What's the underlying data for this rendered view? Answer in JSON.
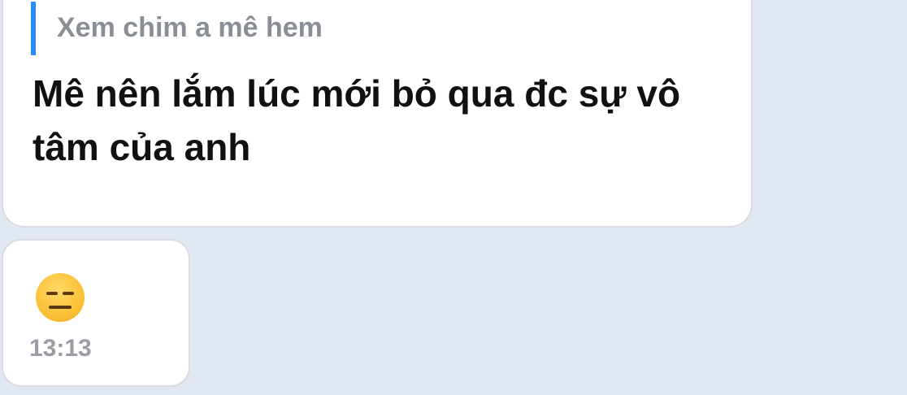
{
  "messages": {
    "main": {
      "quote_text": "Xem chim a mê hem",
      "text": "Mê nên lắm lúc mới bỏ qua đc sự vô tâm của anh"
    },
    "emoji_message": {
      "emoji_icon": "expressionless-face-icon",
      "timestamp": "13:13"
    }
  },
  "colors": {
    "background": "#e2e8f1",
    "bubble": "#ffffff",
    "quote_bar": "#2a8cf0"
  }
}
